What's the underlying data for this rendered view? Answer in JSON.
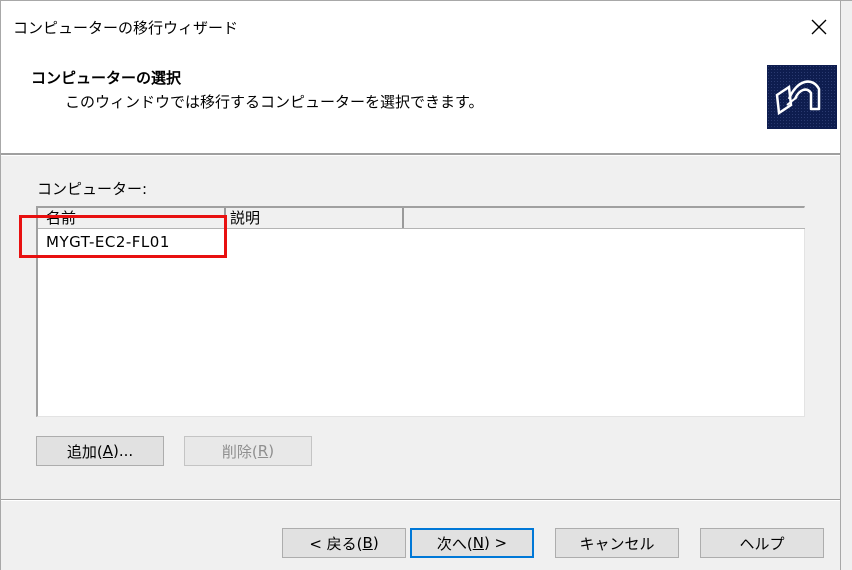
{
  "window": {
    "title": "コンピューターの移行ウィザード"
  },
  "header": {
    "title": "コンピューターの選択",
    "subtitle": "このウィンドウでは移行するコンピューターを選択できます。"
  },
  "computer_list": {
    "label": "コンピューター:",
    "columns": [
      "名前",
      "説明"
    ],
    "rows": [
      {
        "name": "MYGT-EC2-FL01",
        "description": ""
      }
    ]
  },
  "list_buttons": {
    "add": {
      "prefix": "追加(",
      "accel": "A",
      "suffix": ")..."
    },
    "delete": {
      "prefix": "削除(",
      "accel": "R",
      "suffix": ")"
    }
  },
  "footer_buttons": {
    "back": {
      "prefix": "< 戻る(",
      "accel": "B",
      "suffix": ")"
    },
    "next": {
      "prefix": "次へ(",
      "accel": "N",
      "suffix": ") >"
    },
    "cancel": "キャンセル",
    "help": "ヘルプ"
  },
  "colors": {
    "highlight": "#e81010",
    "header_image_bg": "#0e1d4f",
    "default_button_border": "#0078d7"
  },
  "icons": {
    "close": "close-icon",
    "header_image": "wizard-transfer-icon"
  }
}
